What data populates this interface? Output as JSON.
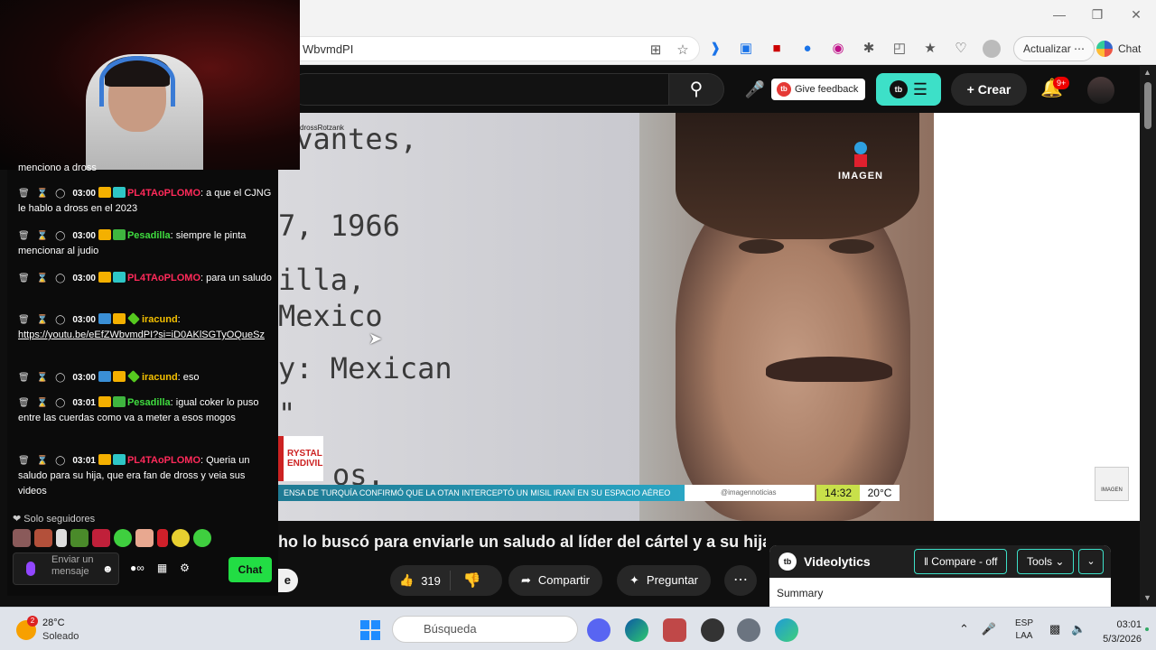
{
  "browser": {
    "address_fragment": "WbvmdPI",
    "update_label": "Actualizar ⋯",
    "chat_label": "Chat"
  },
  "youtube": {
    "feedback_label": "Give feedback",
    "create_label": "Crear",
    "notification_count": "9+"
  },
  "video": {
    "doc_lines": [
      "rvantes,",
      "7, 1966",
      "illa,",
      " Mexico",
      "y: Mexican",
      "\"",
      "os."
    ],
    "doc_small_text": "drossRotzank",
    "channel_logo": "IMAGEN",
    "corner_logo": "IMAGEN",
    "lower_third": "RYSTAL\nENDIVIL",
    "ticker_text": "ENSA DE TURQUÍA CONFIRMÓ QUE LA OTAN INTERCEPTÓ UN MISIL IRANÍ EN SU ESPACIO AÉREO",
    "ticker_handle": "@imagennoticias",
    "ticker_time": "14:32",
    "ticker_temp": "20°C",
    "title": "ho lo buscó para enviarle un saludo al líder del cártel y a su hija"
  },
  "actions": {
    "partial_label": "e",
    "likes": "319",
    "share_label": "Compartir",
    "ask_label": "Preguntar",
    "more_label": "⋯"
  },
  "videolytics": {
    "name": "Videolytics",
    "compare_label": "Compare - off",
    "tools_label": "Tools",
    "summary_label": "Summary"
  },
  "chat": {
    "top_partial": "menciono a dross",
    "messages": [
      {
        "time": "03:00",
        "user": "PL4TAoPLOMO",
        "user_color": "#ff2a5a",
        "text": ": a que el CJNG le hablo a dross en el 2023"
      },
      {
        "time": "03:00",
        "user": "Pesadilla",
        "user_color": "#3fdc3f",
        "text": ": siempre le pinta mencionar al judio"
      },
      {
        "time": "03:00",
        "user": "PL4TAoPLOMO",
        "user_color": "#ff2a5a",
        "text": ": para un saludo"
      },
      {
        "time": "03:00",
        "user": "iracund",
        "user_color": "#f4c000",
        "text": ":",
        "link": "https://youtu.be/eEfZWbvmdPI?si=iD0AKlSGTyOQueSz"
      },
      {
        "time": "03:00",
        "user": "iracund",
        "user_color": "#f4c000",
        "text": ": eso"
      },
      {
        "time": "03:01",
        "user": "Pesadilla",
        "user_color": "#3fdc3f",
        "text": ": igual coker lo puso entre las cuerdas como va a meter a esos mogos"
      },
      {
        "time": "03:01",
        "user": "PL4TAoPLOMO",
        "user_color": "#ff2a5a",
        "text": ": Queria un saludo para su hija, que era fan de dross y veia sus videos"
      }
    ],
    "followers_label": "❤ Solo seguidores",
    "input_placeholder": "Enviar un mensaje",
    "send_label": "Chat"
  },
  "taskbar": {
    "weather_temp": "28°C",
    "weather_condition": "Soleado",
    "weather_badge": "2",
    "search_placeholder": "Búsqueda",
    "lang_line1": "ESP",
    "lang_line2": "LAA",
    "time": "03:01",
    "date": "5/3/2026"
  }
}
